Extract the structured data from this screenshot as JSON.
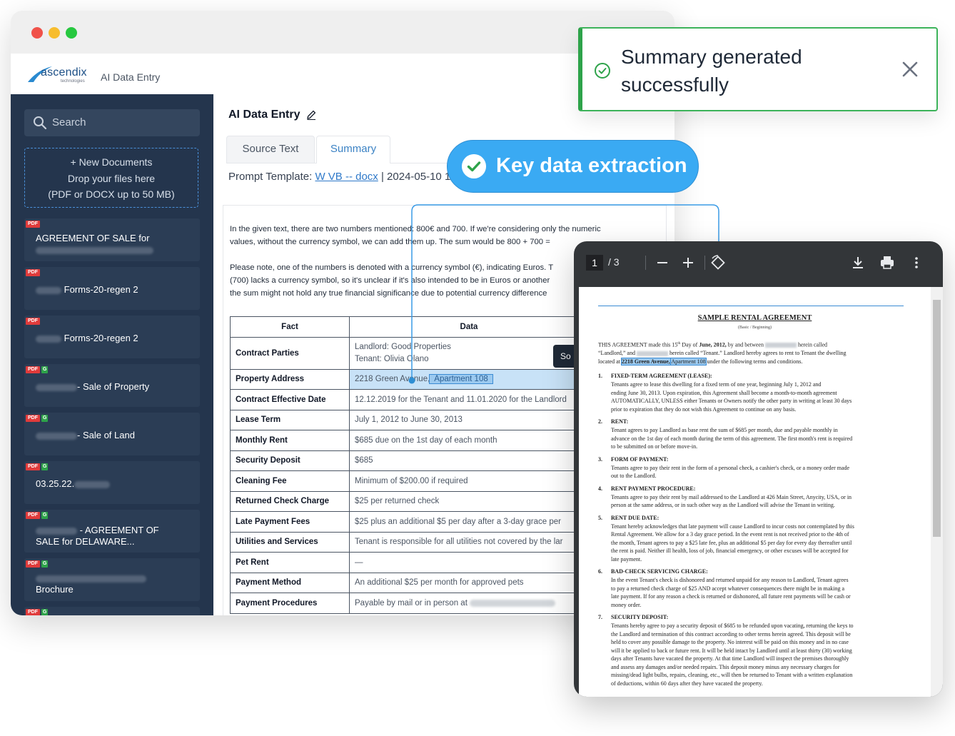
{
  "app": {
    "logo_text": "ascendix",
    "logo_sub": "technologies",
    "title": "AI Data Entry"
  },
  "sidebar": {
    "search_placeholder": "Search",
    "dropzone": {
      "line1": "+ New Documents",
      "line2": "Drop your files here",
      "line3": "(PDF or DOCX up to 50 MB)"
    },
    "documents": [
      {
        "badges": [
          "PDF"
        ],
        "title": "AGREEMENT OF SALE for"
      },
      {
        "badges": [
          "PDF"
        ],
        "title": "Forms-20-regen 2"
      },
      {
        "badges": [
          "PDF"
        ],
        "title": "Forms-20-regen 2"
      },
      {
        "badges": [
          "PDF",
          "G"
        ],
        "title": "- Sale of Property"
      },
      {
        "badges": [
          "PDF",
          "G"
        ],
        "title": "- Sale of Land"
      },
      {
        "badges": [
          "PDF",
          "G"
        ],
        "title": "03.25.22."
      },
      {
        "badges": [
          "PDF",
          "G"
        ],
        "title": "- AGREEMENT OF",
        "title2": "SALE for DELAWARE..."
      },
      {
        "badges": [
          "PDF",
          "G"
        ],
        "title": "Brochure"
      },
      {
        "badges": [
          "PDF",
          "G"
        ],
        "title": ""
      }
    ]
  },
  "main": {
    "title": "AI Data Entry",
    "tabs": [
      "Source Text",
      "Summary"
    ],
    "active_tab": "Summary",
    "prompt": {
      "label": "Prompt Template:",
      "link": "W VB -- docx",
      "date": "| 2024-05-10 1"
    },
    "paragraph1_line1": "In the given text, there are two numbers mentioned: 800€ and 700. If we're considering only the numeric",
    "paragraph1_line2": "values, without the currency symbol, we can add them up. The sum would be 800 + 700 = ",
    "paragraph2_line1": "Please note, one of the numbers is denoted with a currency symbol (€), indicating Euros. T",
    "paragraph2_line2": "(700) lacks a currency symbol, so it's unclear if it's also intended to be in Euros or another",
    "paragraph2_line3": "the sum might not hold any true financial significance due to potential currency difference",
    "table": {
      "headers": [
        "Fact",
        "Data"
      ],
      "tooltip": "So",
      "rows": [
        {
          "fact": "Contract Parties",
          "data": "Landlord: Good Properties",
          "data2": "Tenant: Olivia Olano"
        },
        {
          "fact": "Property Address",
          "data": "2218 Green Avenue,",
          "highlight": "Apartment 108"
        },
        {
          "fact": "Contract Effective Date",
          "data": "12.12.2019 for the Tenant and 11.01.2020 for the Landlord"
        },
        {
          "fact": "Lease Term",
          "data": "July 1, 2012 to June 30, 2013"
        },
        {
          "fact": "Monthly Rent",
          "data": "$685 due on the 1st day of each month"
        },
        {
          "fact": "Security Deposit",
          "data": "$685"
        },
        {
          "fact": "Cleaning Fee",
          "data": "Minimum of $200.00 if required"
        },
        {
          "fact": "Returned Check Charge",
          "data": "$25 per returned check"
        },
        {
          "fact": "Late Payment Fees",
          "data": "$25 plus an additional $5 per day after a 3-day grace per"
        },
        {
          "fact": "Utilities and Services",
          "data": "Tenant is responsible for all utilities not covered by the lar"
        },
        {
          "fact": "Pet Rent",
          "data": "—"
        },
        {
          "fact": "Payment Method",
          "data": "An additional $25 per month for approved pets"
        },
        {
          "fact": "Payment Procedures",
          "data": "Payable by mail or in person at"
        }
      ]
    }
  },
  "callout": {
    "text": "Key data extraction"
  },
  "toast": {
    "message": "Summary generated successfully"
  },
  "viewer": {
    "page": "1",
    "total": "/ 3",
    "document": {
      "title": "SAMPLE RENTAL AGREEMENT",
      "subtitle": "(Basic / Beginning)",
      "intro_1a": "THIS AGREEMENT made this 15",
      "intro_1b": " Day of ",
      "intro_1c": "June, 2012,",
      "intro_1d": " by and between",
      "intro_1e": "herein called",
      "intro_2a": "“Landlord,” and",
      "intro_2b": "herein called “Tenant.” Landlord hereby agrees to rent to Tenant the dwelling",
      "intro_3a": "located at",
      "intro_3b": "2218 Green Avenue,",
      "intro_3c": "Apartment 108",
      "intro_3d": "under the following terms and conditions.",
      "sections": [
        {
          "num": "1.",
          "head": "FIXED-TERM AGREEMENT (LEASE):",
          "lines": [
            "Tenants agree to lease this dwelling for a fixed term of one year, beginning July 1, 2012 and",
            "ending June 30, 2013. Upon expiration, this Agreement shall become a month-to-month agreement",
            "AUTOMATICALLY, UNLESS either Tenants or Owners notify the other party in writing at least 30 days",
            "prior to expiration that they do not wish this Agreement to continue on any basis."
          ]
        },
        {
          "num": "2.",
          "head": "RENT:",
          "lines": [
            "Tenant agrees to pay Landlord as base rent the sum of $685 per month, due and payable monthly in",
            "advance on the 1st day of each month during the term of this agreement. The first month's rent is required",
            "to be submitted on or before move-in."
          ]
        },
        {
          "num": "3.",
          "head": "FORM OF PAYMENT:",
          "lines": [
            "Tenants agree to pay their rent in the form of a personal check, a cashier's check, or a money order made",
            "out to the Landlord."
          ]
        },
        {
          "num": "4.",
          "head": "RENT PAYMENT PROCEDURE:",
          "lines": [
            "Tenants agree to pay their rent by mail addressed to the Landlord at 426 Main Street, Anycity, USA, or in",
            "person at the same address, or in such other way as the Landlord will advise the Tenant in writing."
          ]
        },
        {
          "num": "5.",
          "head": "RENT DUE DATE:",
          "lines": [
            "Tenant hereby acknowledges that late payment will cause Landlord to incur costs not contemplated by this",
            "Rental Agreement. We allow for a 3 day grace period. In the event rent is not received prior to the 4th of",
            "the month, Tenant agrees to pay a $25 late fee, plus an additional $5 per day for every day thereafter until",
            "the rent is paid. Neither ill health, loss of job, financial emergency, or other excuses will be accepted for",
            "late payment."
          ]
        },
        {
          "num": "6.",
          "head": "BAD-CHECK SERVICING CHARGE:",
          "lines": [
            "In the event Tenant's check is dishonored and returned unpaid for any reason to Landlord, Tenant agrees",
            "to pay a returned check charge of $25 AND accept whatever consequences there might be in making a",
            "late payment. If for any reason a check is returned or dishonored, all future rent payments will be cash or",
            "money order."
          ]
        },
        {
          "num": "7.",
          "head": "SECURITY DEPOSIT:",
          "lines": [
            "Tenants hereby agree to pay a security deposit of $685 to be refunded upon vacating, returning the keys to",
            "the Landlord and termination of this contract according to other terms herein agreed. This deposit will be",
            "held to cover any possible damage to the property. No interest will be paid on this money and in no case",
            "will it be applied to back or future rent. It will be held intact by Landlord until at least thirty (30) working",
            "days after Tenants have vacated the property. At that time Landlord will inspect the premises thoroughly",
            "and assess any damages and/or needed repairs. This deposit money minus any necessary charges for",
            "missing/dead light bulbs, repairs, cleaning, etc., will then be returned to Tenant with a written explanation",
            "of deductions, within 60 days after they have vacated the property."
          ]
        }
      ]
    }
  },
  "colors": {
    "sidebar": "#24354d",
    "accent": "#3aaaf3",
    "success": "#2ea34a",
    "link": "#2f79c9"
  }
}
